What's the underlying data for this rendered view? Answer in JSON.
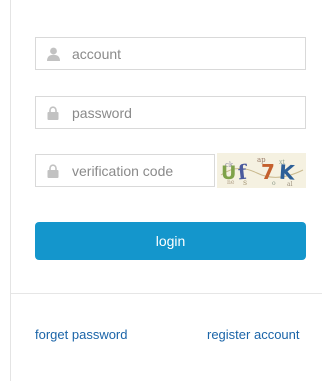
{
  "login_form": {
    "account": {
      "placeholder": "account",
      "value": "",
      "icon": "user-icon"
    },
    "password": {
      "placeholder": "password",
      "value": "",
      "icon": "lock-icon"
    },
    "verification": {
      "placeholder": "verification code",
      "value": "",
      "icon": "lock-icon"
    },
    "captcha": {
      "text": "Uf7K"
    },
    "login_label": "login"
  },
  "footer": {
    "forget_label": "forget password",
    "register_label": "register account"
  },
  "colors": {
    "accent": "#1496cc",
    "link": "#1a64a8",
    "border": "#d9d9d9",
    "icon": "#c2c2c2"
  }
}
